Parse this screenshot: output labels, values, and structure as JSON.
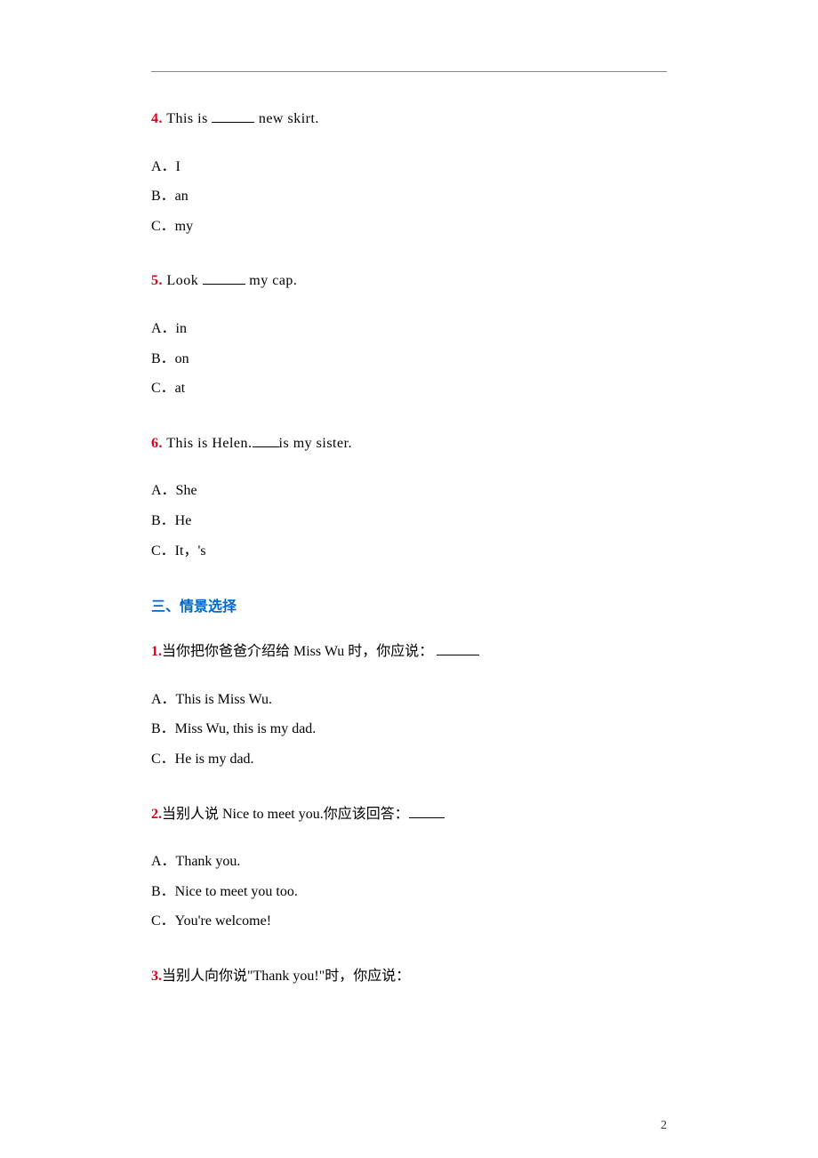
{
  "page_number": "2",
  "section2": {
    "questions": [
      {
        "num": "4.",
        "stem_prefix": "  This is ",
        "stem_suffix": " new skirt.",
        "options": [
          "A．I",
          "B．an",
          "C．my"
        ]
      },
      {
        "num": "5.",
        "stem_prefix": "  Look ",
        "stem_suffix": " my cap.",
        "options": [
          "A．in",
          "B．on",
          "C．at"
        ]
      },
      {
        "num": "6.",
        "stem_prefix": "  This is Helen.",
        "stem_suffix": "is my sister.",
        "options": [
          "A．She",
          "B．He",
          "C．It，'s"
        ]
      }
    ]
  },
  "section3": {
    "title": "三、情景选择",
    "questions": [
      {
        "num": "1.",
        "stem_prefix": "当你把你爸爸介绍给 Miss Wu 时，你应说： ",
        "stem_suffix": "",
        "options": [
          "A．This is Miss Wu.",
          "B．Miss Wu, this is my dad.",
          "C．He is my dad."
        ]
      },
      {
        "num": "2.",
        "stem_prefix": "当别人说 Nice to meet you.你应该回答：",
        "stem_suffix": "",
        "options": [
          "A．Thank you.",
          "B．Nice to meet you too.",
          "C．You're welcome!"
        ]
      },
      {
        "num": "3.",
        "stem_prefix": "当别人向你说\"Thank you!\"时，你应说：",
        "stem_suffix": "",
        "options": []
      }
    ]
  }
}
